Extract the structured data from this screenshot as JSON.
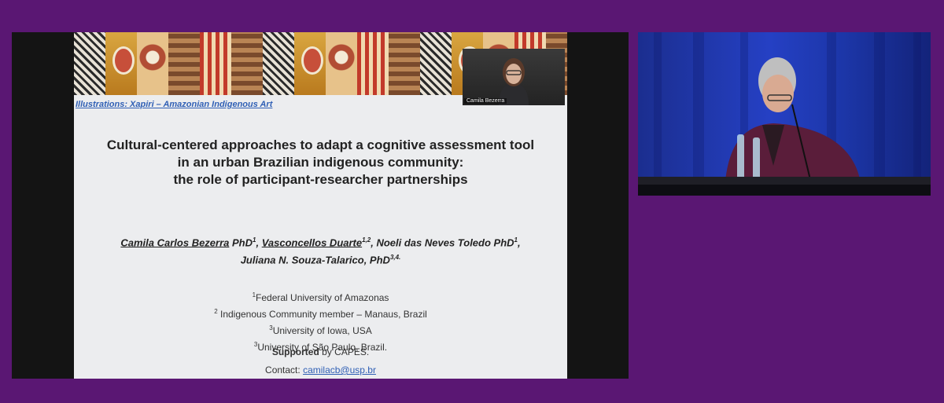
{
  "slide": {
    "credit": "Illustrations: Xapiri – Amazonian Indigenous Art",
    "title_lines": [
      "Cultural-centered approaches to adapt a cognitive assessment tool",
      "in an urban Brazilian indigenous community:",
      "the role of participant-researcher partnerships"
    ],
    "authors": {
      "a1": "Camila Carlos Bezerra",
      "a1_suffix": " PhD",
      "a1_sup": "1",
      "a2": "Vasconcellos Duarte",
      "a2_sup": "1,2",
      "a3": "Noeli das Neves Toledo PhD",
      "a3_sup": "1",
      "a4": "Juliana N. Souza-Talarico, PhD",
      "a4_sup": "3,4."
    },
    "affiliations": [
      {
        "sup": "1",
        "text": "Federal University of Amazonas"
      },
      {
        "sup": "2",
        "text": " Indigenous Community member – Manaus, Brazil"
      },
      {
        "sup": "3",
        "text": "University of Iowa, USA"
      },
      {
        "sup": "3",
        "text": "University of São Paulo, Brazil."
      }
    ],
    "support_bold": "Supported",
    "support_rest": " by CAPES.",
    "contact_label": "Contact: ",
    "contact_email": "camilacb@usp.br"
  },
  "inset_video": {
    "name": "Camila Bezerra"
  },
  "colors": {
    "background": "#5a1773",
    "link": "#2f5fb5",
    "stage": "#2540c4"
  }
}
